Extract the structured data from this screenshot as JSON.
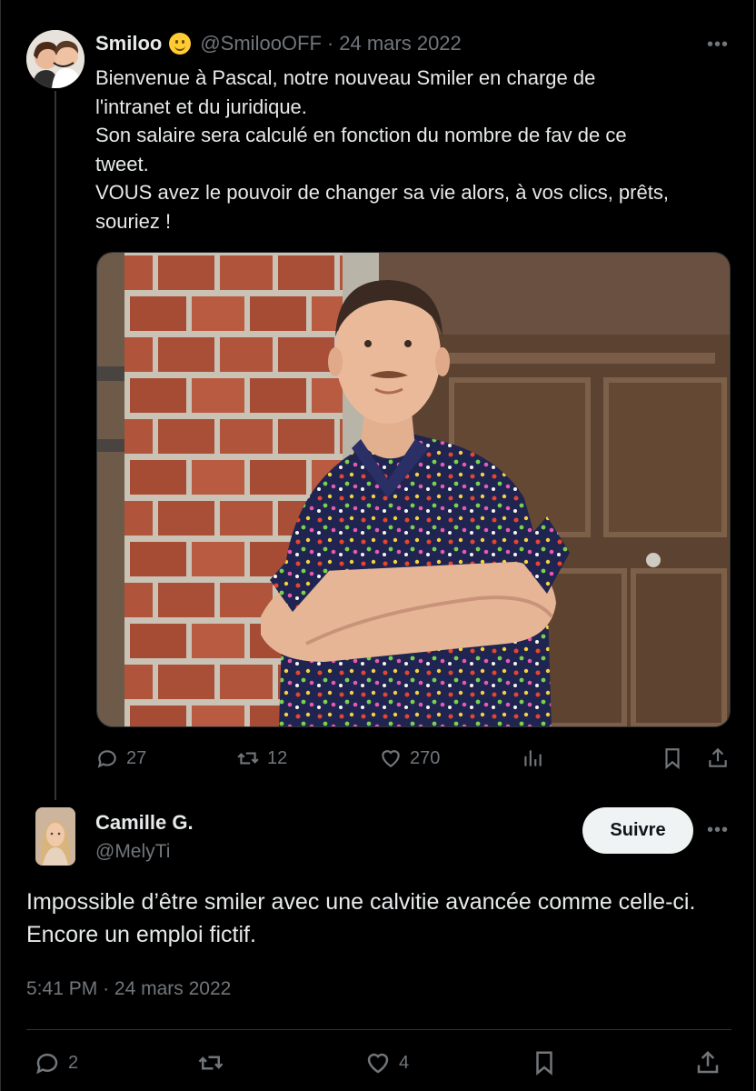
{
  "tweet": {
    "name": "Smiloo",
    "emoji": "slightly-smiling-face",
    "handle": "@SmilooOFF",
    "separator": "·",
    "date": "24 mars 2022",
    "text": "Bienvenue à Pascal, notre nouveau Smiler en charge de\nl'intranet et du juridique.\nSon salaire sera calculé en fonction du nombre de fav de ce\ntweet.\nVOUS avez le pouvoir de changer sa vie alors, à vos clics, prêts,\nsouriez !",
    "image": "photo of a man with a mustache in a floral shirt, arms crossed, leaning against a brick wall next to a wooden door",
    "stats": {
      "replies": "27",
      "retweets": "12",
      "likes": "270"
    }
  },
  "reply": {
    "name": "Camille G.",
    "handle": "@MelyTi",
    "follow_label": "Suivre",
    "text": "Impossible d’être smiler avec une calvitie avancée comme celle-ci. Encore un emploi fictif.",
    "time": "5:41 PM",
    "separator": "·",
    "date": "24 mars 2022",
    "stats": {
      "replies": "2",
      "likes": "4"
    }
  },
  "icons": [
    "reply-icon",
    "retweet-icon",
    "like-icon",
    "views-icon",
    "bookmark-icon",
    "share-icon",
    "more-icon"
  ],
  "colors": {
    "background": "#000000",
    "text": "#e7e9ea",
    "muted": "#71767b",
    "follow_bg": "#eff3f4"
  }
}
